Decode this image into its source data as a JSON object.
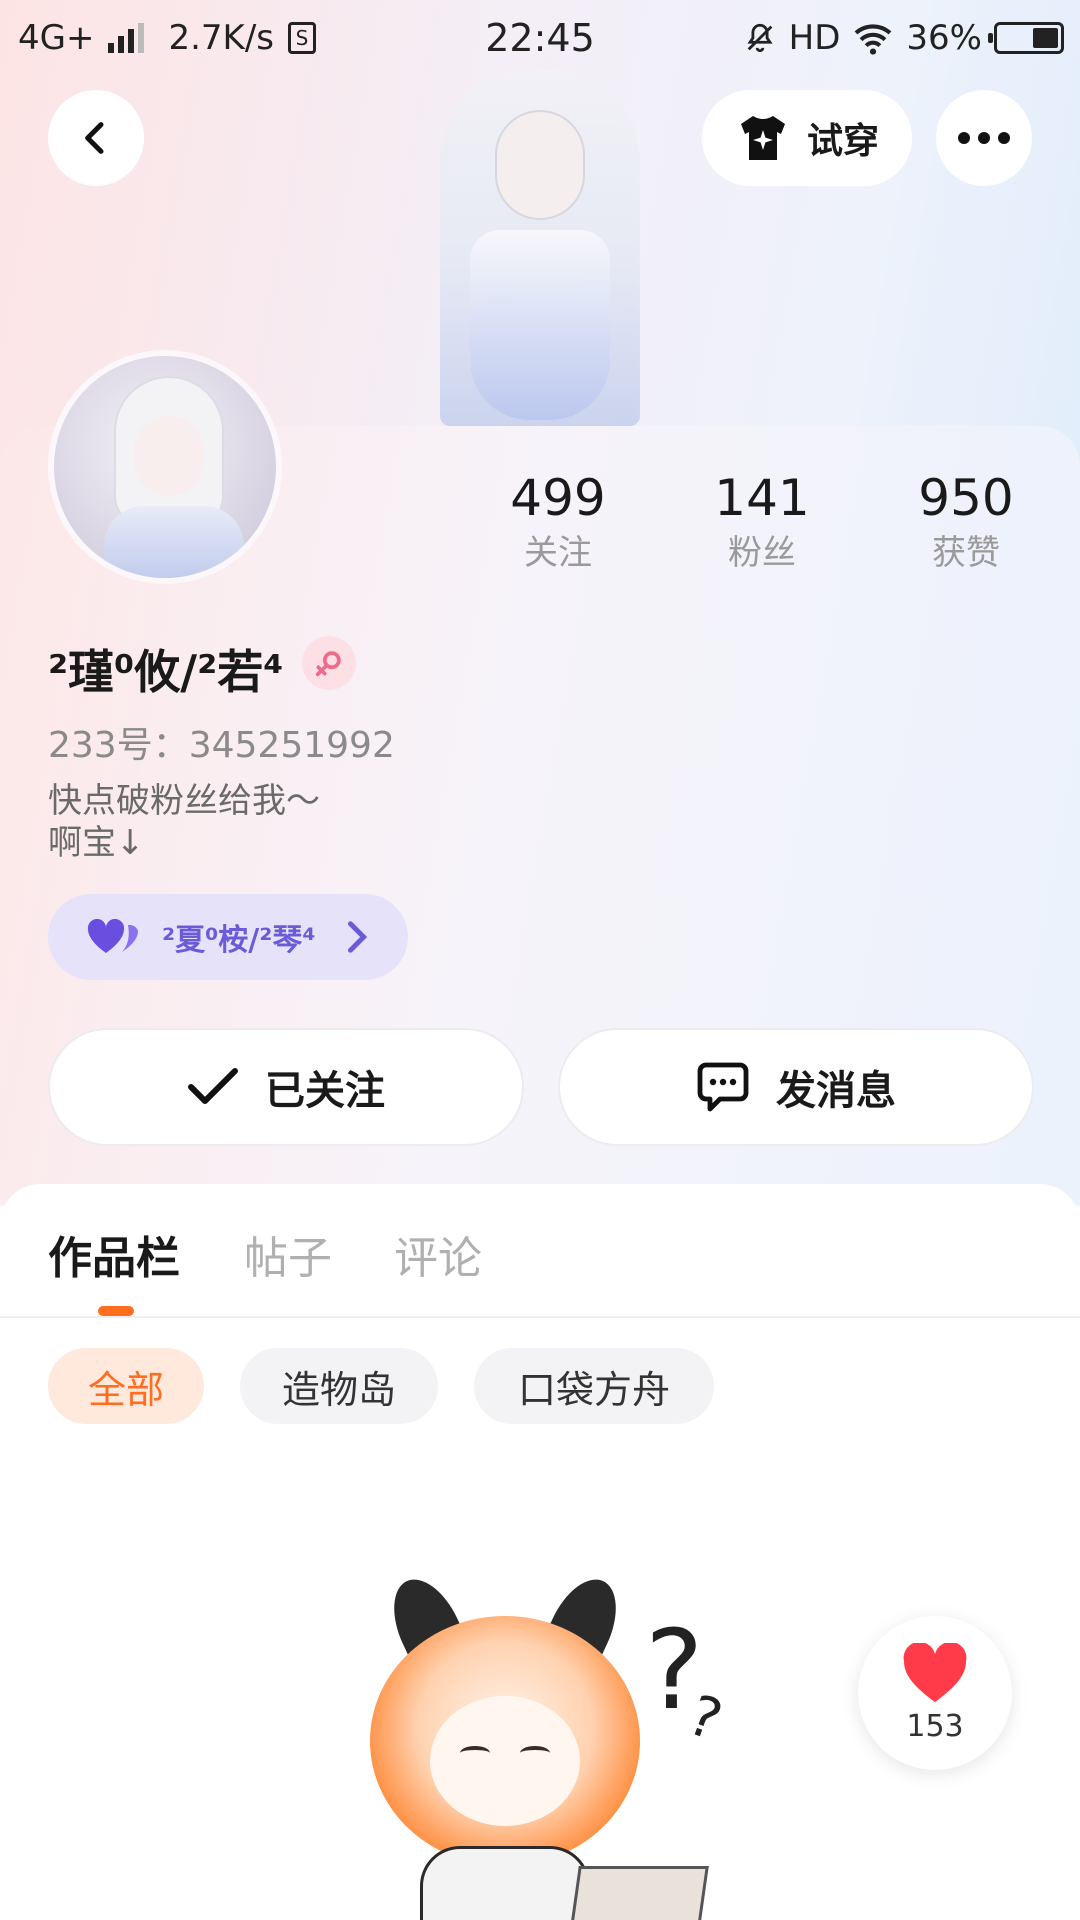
{
  "status_bar": {
    "network": "4G+",
    "speed": "2.7K/s",
    "time": "22:45",
    "hd": "HD",
    "battery": "36%"
  },
  "header": {
    "try_on_label": "试穿",
    "icons": [
      "back-icon",
      "shirt-sparkle-icon",
      "more-icon"
    ]
  },
  "profile": {
    "username": "²瑾⁰攸/²若⁴",
    "uid": "233号：345251992",
    "bio": "快点破粉丝给我～\n啊宝↓",
    "gender_icon": "female-icon",
    "relation_name": "²夏⁰桉/²琴⁴",
    "stats": [
      {
        "value": "499",
        "label": "关注"
      },
      {
        "value": "141",
        "label": "粉丝"
      },
      {
        "value": "950",
        "label": "获赞"
      }
    ]
  },
  "actions": {
    "followed_label": "已关注",
    "message_label": "发消息"
  },
  "tabs": [
    {
      "label": "作品栏",
      "active": true
    },
    {
      "label": "帖子",
      "active": false
    },
    {
      "label": "评论",
      "active": false
    }
  ],
  "filters": [
    {
      "label": "全部",
      "active": true
    },
    {
      "label": "造物岛",
      "active": false
    },
    {
      "label": "口袋方舟",
      "active": false
    }
  ],
  "like_fab": {
    "count": "153"
  },
  "colors": {
    "accent": "#ff6d1f",
    "relation_pill_bg": "#e6e2fa",
    "relation_text": "#6a5cd8",
    "heart": "#ff3b4a"
  }
}
